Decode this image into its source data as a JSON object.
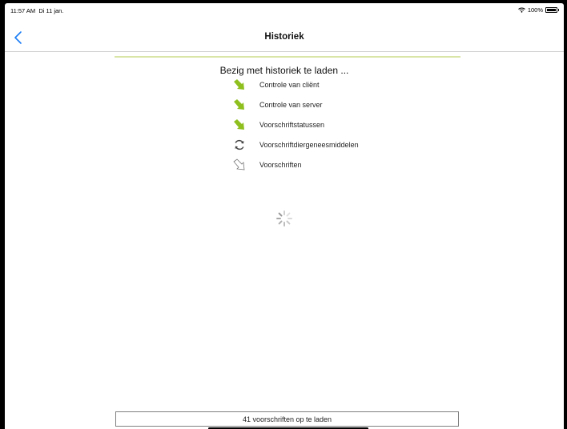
{
  "status_bar": {
    "time": "11:57 AM",
    "date": "Di 11 jan.",
    "battery": "100%"
  },
  "nav": {
    "title": "Historiek",
    "back_icon": "chevron-left-icon"
  },
  "colors": {
    "accent": "#1a7cf5",
    "done_arrow": "#8ebf1f",
    "progress_line": "#d8e5a6"
  },
  "loading": {
    "title": "Bezig met historiek te laden ...",
    "steps": [
      {
        "label": "Controle van cliënt",
        "state": "done",
        "icon": "green-arrow-icon"
      },
      {
        "label": "Controle van server",
        "state": "done",
        "icon": "green-arrow-icon"
      },
      {
        "label": "Voorschriftstatussen",
        "state": "done",
        "icon": "green-arrow-icon"
      },
      {
        "label": "Voorschriftdiergeneesmiddelen",
        "state": "in-progress",
        "icon": "refresh-icon"
      },
      {
        "label": "Voorschriften",
        "state": "pending",
        "icon": "outline-arrow-icon"
      }
    ]
  },
  "footer": {
    "status": "41 voorschriften op te laden"
  }
}
